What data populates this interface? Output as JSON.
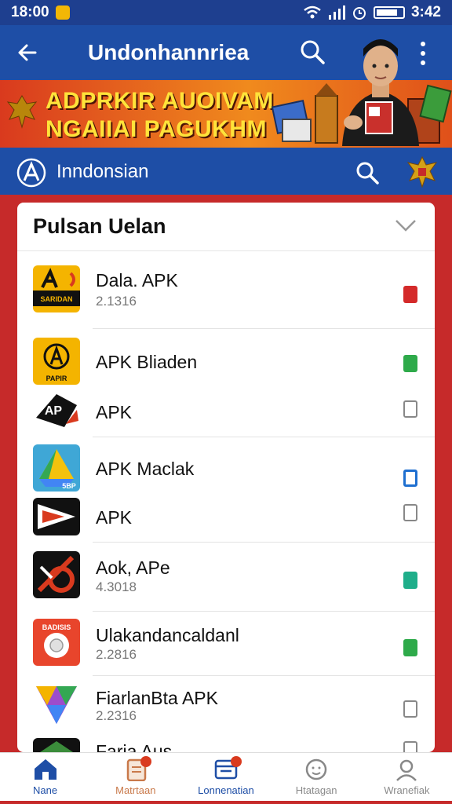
{
  "status": {
    "time_left": "18:00",
    "time_right": "3:42",
    "battery_level": 0.8
  },
  "app_bar": {
    "title": "Undonhannriea",
    "back_icon": "back-arrow-icon",
    "search_icon": "search-icon",
    "more_icon": "more-vert-icon"
  },
  "banner": {
    "line1": "ADPRKIR AUOIVAM",
    "line2": "NGAIIAI PAGUKHM"
  },
  "search": {
    "label": "Inndonsian"
  },
  "list": {
    "title": "Pulsan Uelan",
    "items": [
      {
        "name": "Dala. APK",
        "sub": "2.1316",
        "icon_text": "SARIDAN",
        "status": "red"
      },
      {
        "name": "APK Bliaden",
        "sub": "",
        "icon_text": "PAPIR",
        "status": "green"
      },
      {
        "name": "APK",
        "sub": "",
        "icon_text": "AP",
        "status": "empty"
      },
      {
        "name": "APK Maclak",
        "sub": "",
        "icon_text": "5BP",
        "status": "blue"
      },
      {
        "name": "APK",
        "sub": "",
        "icon_text": "",
        "status": "empty"
      },
      {
        "name": "Aok, APe",
        "sub": "4.3018",
        "icon_text": "",
        "status": "teal"
      },
      {
        "name": "Ulakandancaldanl",
        "sub": "2.2816",
        "icon_text": "BADISIS",
        "status": "green"
      },
      {
        "name": "FiarlanBta APK",
        "sub": "2.2316",
        "icon_text": "",
        "status": "empty"
      },
      {
        "name": "Faria Aus",
        "sub": "",
        "icon_text": "",
        "status": "empty"
      }
    ]
  },
  "bottom_nav": [
    {
      "label": "Nane",
      "icon": "home-icon",
      "active": true
    },
    {
      "label": "Matrtaan",
      "icon": "document-icon",
      "active": false
    },
    {
      "label": "Lonnenatian",
      "icon": "inbox-icon",
      "active": false
    },
    {
      "label": "Htatagan",
      "icon": "face-icon",
      "active": false
    },
    {
      "label": "Wranefiak",
      "icon": "profile-icon",
      "active": false
    }
  ],
  "colors": {
    "primary": "#1e4ea6",
    "status_bar": "#1e3f8f",
    "background": "#c62a2a",
    "accent_red": "#d93a1e",
    "accent_yellow": "#ffe33a"
  }
}
